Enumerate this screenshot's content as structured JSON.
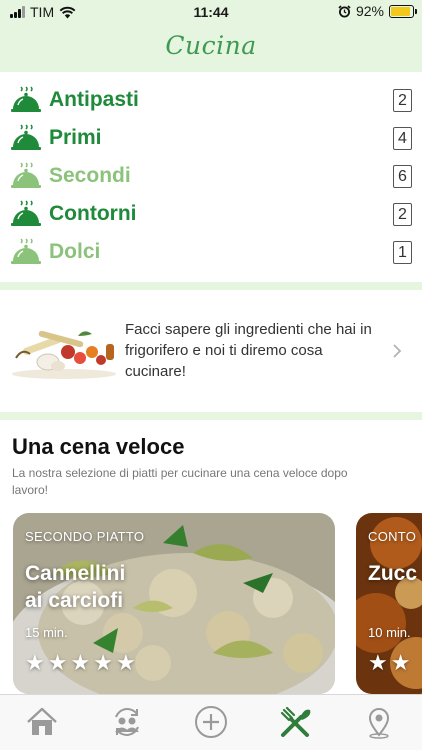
{
  "status_bar": {
    "carrier": "TIM",
    "time": "11:44",
    "battery": "92%",
    "battery_level": 0.92,
    "icons": [
      "signal-icon",
      "wifi-icon",
      "alarm-icon",
      "battery-icon"
    ]
  },
  "header": {
    "title": "Cucina"
  },
  "categories": [
    {
      "name": "Antipasti",
      "count": "2",
      "style": "dark"
    },
    {
      "name": "Primi",
      "count": "4",
      "style": "dark"
    },
    {
      "name": "Secondi",
      "count": "6",
      "style": "light"
    },
    {
      "name": "Contorni",
      "count": "2",
      "style": "dark"
    },
    {
      "name": "Dolci",
      "count": "1",
      "style": "light"
    }
  ],
  "promo": {
    "text": "Facci sapere gli ingredienti che hai in frigorifero e noi ti diremo cosa cucinare!"
  },
  "section": {
    "title": "Una cena veloce",
    "description": "La nostra selezione di piatti per cucinare una cena veloce dopo lavoro!"
  },
  "cards": [
    {
      "kicker": "SECONDO PIATTO",
      "title_line1": "Cannellini",
      "title_line2": "ai carciofi",
      "time": "15 min.",
      "stars": [
        "★",
        "★",
        "★",
        "★",
        "★"
      ],
      "rating": 5
    },
    {
      "kicker": "CONTO",
      "title_line1": "Zucc",
      "time": "10 min.",
      "stars": [
        "★",
        "★"
      ]
    }
  ],
  "tab_bar": {
    "items": [
      "home-icon",
      "users-sync-icon",
      "add-icon",
      "cutlery-icon",
      "location-pin-icon"
    ],
    "active": "cutlery-icon"
  },
  "colors": {
    "header_bg": "#e6f5df",
    "accent_dark": "#1e8a3a",
    "accent_light": "#8cc37b",
    "tab_active": "#2f7d3a",
    "tab_inactive": "#9a9a9a"
  }
}
